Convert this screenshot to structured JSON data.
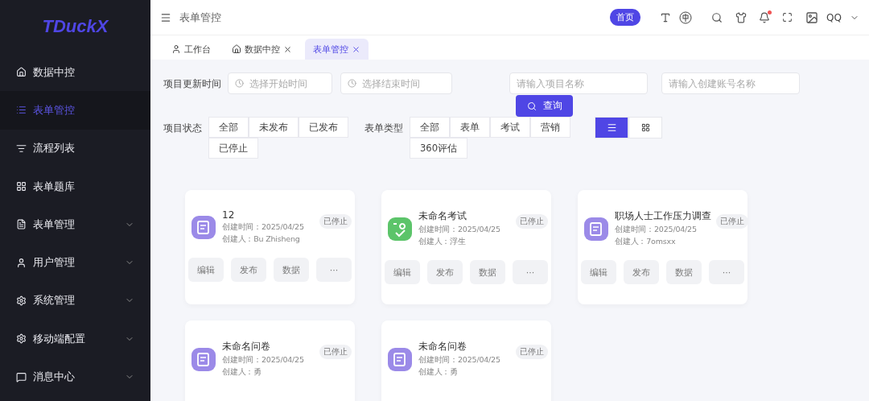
{
  "logo": "TDuckX",
  "sidebar": {
    "items": [
      {
        "label": "数据中控",
        "selected": false,
        "expandable": false
      },
      {
        "label": "表单管控",
        "selected": true,
        "expandable": false
      },
      {
        "label": "流程列表",
        "selected": false,
        "expandable": false
      },
      {
        "label": "表单题库",
        "selected": false,
        "expandable": false
      },
      {
        "label": "表单管理",
        "selected": false,
        "expandable": true
      },
      {
        "label": "用户管理",
        "selected": false,
        "expandable": true
      },
      {
        "label": "系统管理",
        "selected": false,
        "expandable": true
      },
      {
        "label": "移动端配置",
        "selected": false,
        "expandable": true
      },
      {
        "label": "消息中心",
        "selected": false,
        "expandable": true
      }
    ]
  },
  "header": {
    "breadcrumb": "表单管控",
    "home_button": "首页",
    "user": "QQ",
    "notification": true
  },
  "tabs": [
    {
      "label": "工作台",
      "closable": false,
      "selected": false
    },
    {
      "label": "数据中控",
      "closable": true,
      "selected": false
    },
    {
      "label": "表单管控",
      "closable": true,
      "selected": true
    }
  ],
  "filters": {
    "time_label": "项目更新时间",
    "start_placeholder": "选择开始时间",
    "end_placeholder": "选择结束时间",
    "name_placeholder": "请输入项目名称",
    "account_placeholder": "请输入创建账号名称",
    "query_button": "查询",
    "status_label": "项目状态",
    "status_options": [
      {
        "label": "全部",
        "selected": false
      },
      {
        "label": "未发布",
        "selected": false
      },
      {
        "label": "已发布",
        "selected": false
      },
      {
        "label": "已停止",
        "selected": false
      }
    ],
    "type_label": "表单类型",
    "type_options": [
      {
        "label": "全部",
        "selected": false
      },
      {
        "label": "表单",
        "selected": false
      },
      {
        "label": "考试",
        "selected": false
      },
      {
        "label": "营销",
        "selected": false
      },
      {
        "label": "360评估",
        "selected": false
      }
    ],
    "view_modes": [
      {
        "kind": "list",
        "selected": true
      },
      {
        "kind": "grid",
        "selected": false
      }
    ]
  },
  "cards": [
    {
      "title": "12",
      "kind": "survey",
      "created": "创建时间：2025/04/25",
      "creator": "创建人：Bu Zhisheng",
      "status": "已停止",
      "actions": [
        "编辑",
        "发布",
        "数据",
        "···"
      ]
    },
    {
      "title": "未命名考试",
      "kind": "exam",
      "created": "创建时间：2025/04/25",
      "creator": "创建人：浮生",
      "status": "已停止",
      "actions": [
        "编辑",
        "发布",
        "数据",
        "···"
      ]
    },
    {
      "title": "职场人士工作压力调查",
      "kind": "survey",
      "created": "创建时间：2025/04/25",
      "creator": "创建人：7omsxx",
      "status": "已停止",
      "actions": [
        "编辑",
        "发布",
        "数据",
        "···"
      ]
    },
    {
      "title": "未命名问卷",
      "kind": "survey",
      "created": "创建时间：2025/04/25",
      "creator": "创建人：勇",
      "status": "已停止"
    },
    {
      "title": "未命名问卷",
      "kind": "survey",
      "created": "创建时间：2025/04/25",
      "creator": "创建人：勇",
      "status": "已停止"
    }
  ]
}
